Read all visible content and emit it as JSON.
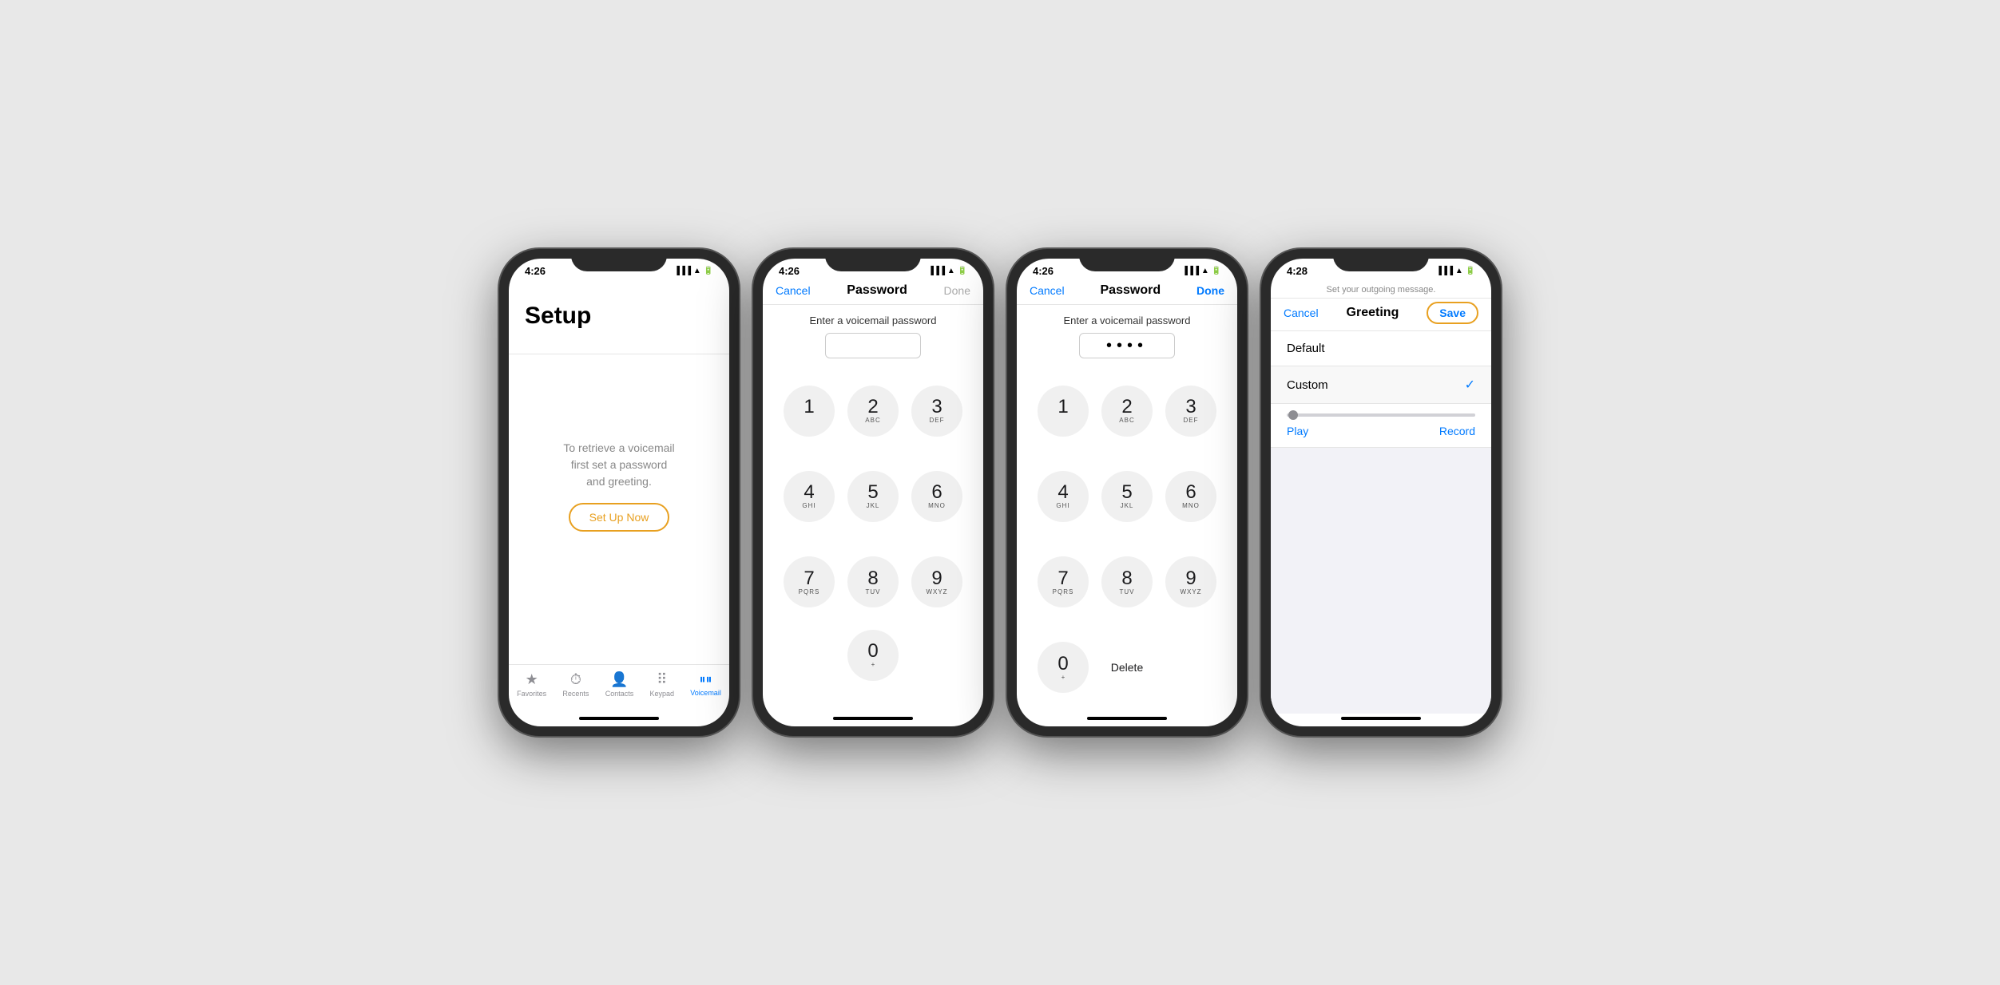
{
  "phones": [
    {
      "id": "phone1",
      "time": "4:26",
      "screen": "setup",
      "title": "Setup",
      "setupText": "To retrieve a voicemail\nfirst set a password\nand greeting.",
      "setupButton": "Set Up Now",
      "tabs": [
        {
          "label": "Favorites",
          "icon": "★",
          "active": false
        },
        {
          "label": "Recents",
          "icon": "🕐",
          "active": false
        },
        {
          "label": "Contacts",
          "icon": "👤",
          "active": false
        },
        {
          "label": "Keypad",
          "icon": "⠿",
          "active": false
        },
        {
          "label": "Voicemail",
          "icon": "⌇⌇",
          "active": true
        }
      ]
    },
    {
      "id": "phone2",
      "time": "4:26",
      "screen": "password-empty",
      "navTitle": "Password",
      "cancelLabel": "Cancel",
      "doneLabel": "Done",
      "doneActive": false,
      "passwordLabel": "Enter a voicemail password",
      "passwordValue": "",
      "keys": [
        {
          "num": "1",
          "sub": ""
        },
        {
          "num": "2",
          "sub": "ABC"
        },
        {
          "num": "3",
          "sub": "DEF"
        },
        {
          "num": "4",
          "sub": "GHI"
        },
        {
          "num": "5",
          "sub": "JKL"
        },
        {
          "num": "6",
          "sub": "MNO"
        },
        {
          "num": "7",
          "sub": "PQRS"
        },
        {
          "num": "8",
          "sub": "TUV"
        },
        {
          "num": "9",
          "sub": "WXYZ"
        },
        {
          "num": "0",
          "sub": "+"
        }
      ]
    },
    {
      "id": "phone3",
      "time": "4:26",
      "screen": "password-filled",
      "navTitle": "Password",
      "cancelLabel": "Cancel",
      "doneLabel": "Done",
      "doneActive": true,
      "passwordLabel": "Enter a voicemail password",
      "passwordValue": "••••",
      "deleteLabel": "Delete",
      "keys": [
        {
          "num": "1",
          "sub": ""
        },
        {
          "num": "2",
          "sub": "ABC"
        },
        {
          "num": "3",
          "sub": "DEF"
        },
        {
          "num": "4",
          "sub": "GHI"
        },
        {
          "num": "5",
          "sub": "JKL"
        },
        {
          "num": "6",
          "sub": "MNO"
        },
        {
          "num": "7",
          "sub": "PQRS"
        },
        {
          "num": "8",
          "sub": "TUV"
        },
        {
          "num": "9",
          "sub": "WXYZ"
        },
        {
          "num": "0",
          "sub": "+"
        }
      ]
    },
    {
      "id": "phone4",
      "time": "4:28",
      "screen": "greeting",
      "navTitle": "Greeting",
      "cancelLabel": "Cancel",
      "saveLabel": "Save",
      "subText": "Set your outgoing message.",
      "options": [
        {
          "label": "Default",
          "selected": false
        },
        {
          "label": "Custom",
          "selected": true
        }
      ],
      "playLabel": "Play",
      "recordLabel": "Record"
    }
  ],
  "colors": {
    "accent": "#007AFF",
    "orange": "#E8A020",
    "gray": "#8e8e93"
  }
}
